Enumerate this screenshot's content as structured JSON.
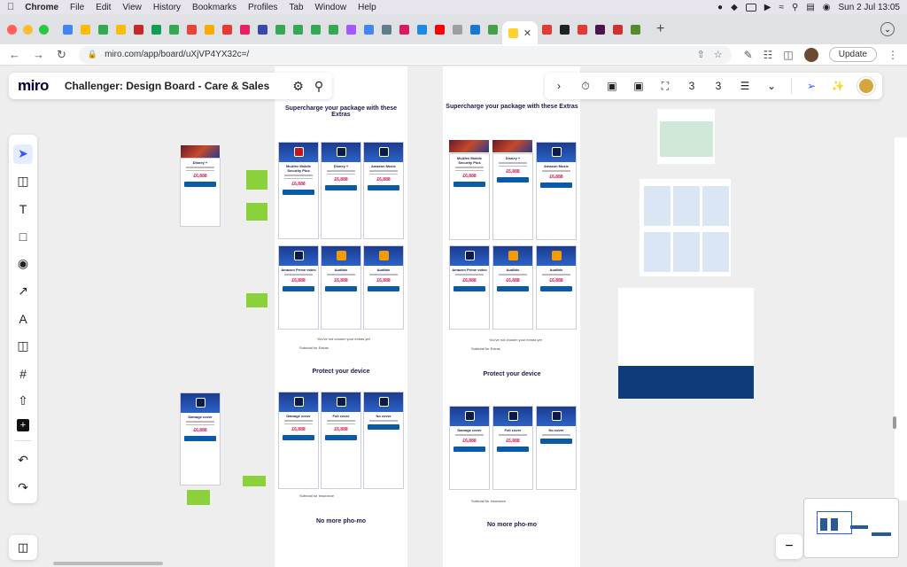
{
  "menubar": {
    "app": "Chrome",
    "items": [
      "File",
      "Edit",
      "View",
      "History",
      "Bookmarks",
      "Profiles",
      "Tab",
      "Window",
      "Help"
    ],
    "clock": "Sun 2 Jul  13:05"
  },
  "browser": {
    "url": "miro.com/app/board/uXjVP4YX32c=/",
    "update_label": "Update"
  },
  "miro": {
    "logo": "miro",
    "board_title": "Challenger: Design Board - Care & Sales",
    "counter_a": "3",
    "counter_b": "3"
  },
  "board": {
    "extras_title": "Supercharge your package with these Extras",
    "protect_title": "Protect your device",
    "phomo_title": "No more pho-mo",
    "subtotal_extras": "Subtotal for Extras",
    "subtotal_insurance": "Subtotal for Insurance",
    "not_chosen": "You've not chosen your extras yet",
    "cards_row1": [
      "McAfee Mobile Security Plus",
      "Disney +",
      "Amazon Music"
    ],
    "cards_row2": [
      "Amazon Prime video",
      "Audible",
      "Audible"
    ],
    "cards_insurance": [
      "Damage cover",
      "Full cover",
      "No cover"
    ],
    "side_card_1": "Disney +",
    "side_card_2": "Damage cover",
    "price": "£6,888",
    "add_button": "Add this extra to your plan"
  }
}
